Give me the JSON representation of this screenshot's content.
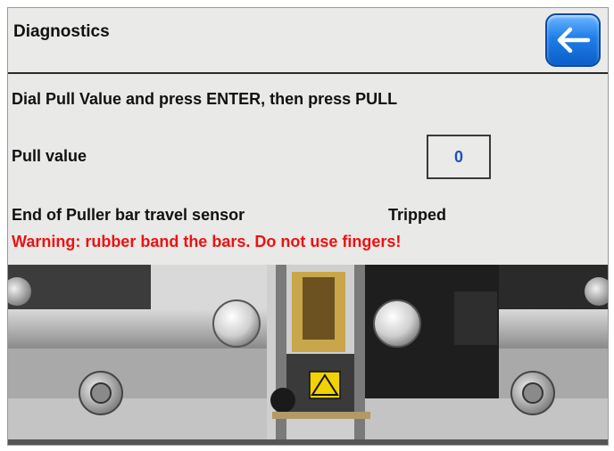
{
  "header": {
    "title": "Diagnostics",
    "back_icon": "left-arrow-icon"
  },
  "instruction": "Dial Pull Value and press ENTER, then press PULL",
  "pull": {
    "label": "Pull value",
    "value": "0"
  },
  "sensor": {
    "label": "End of Puller bar travel sensor",
    "status": "Tripped"
  },
  "warning": "Warning: rubber band the bars. Do not use fingers!",
  "colors": {
    "warning": "#ee1111",
    "value_text": "#1f4fbf",
    "back_button": "#1f7fe9"
  }
}
